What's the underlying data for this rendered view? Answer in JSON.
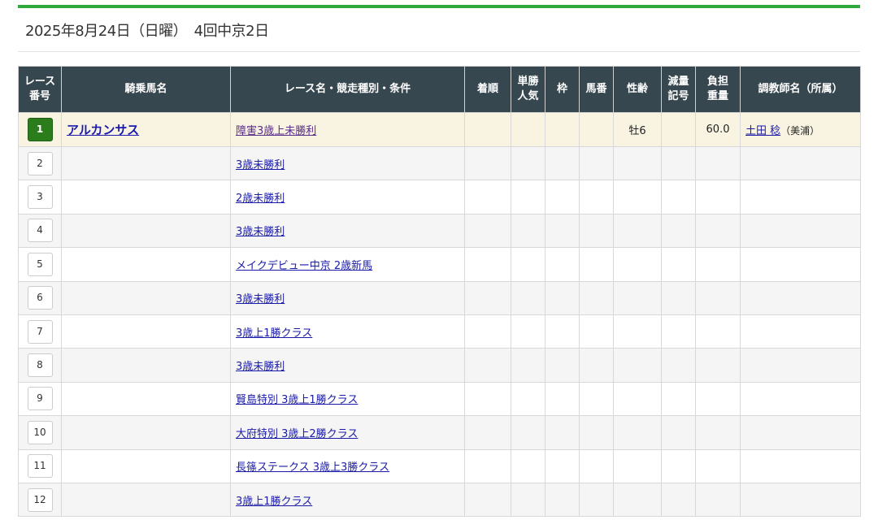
{
  "title": "2025年8月24日（日曜）　4回中京2日",
  "headers": [
    "レース\n番号",
    "騎乗馬名",
    "レース名・競走種別・条件",
    "着順",
    "単勝\n人気",
    "枠",
    "馬番",
    "性齢",
    "減量\n記号",
    "負担\n重量",
    "調教師名（所属）"
  ],
  "rows": [
    {
      "no": "1",
      "horse": "アルカンサス",
      "race": "障害3歳上未勝利",
      "sexage": "牡6",
      "weight": "60.0",
      "trainer": "土田 稔",
      "affil": "（美浦）"
    },
    {
      "no": "2",
      "race": "3歳未勝利"
    },
    {
      "no": "3",
      "race": "2歳未勝利"
    },
    {
      "no": "4",
      "race": "3歳未勝利"
    },
    {
      "no": "5",
      "race": "メイクデビュー中京 2歳新馬"
    },
    {
      "no": "6",
      "race": "3歳未勝利"
    },
    {
      "no": "7",
      "race": "3歳上1勝クラス"
    },
    {
      "no": "8",
      "race": "3歳未勝利"
    },
    {
      "no": "9",
      "race": "賢島特別 3歳上1勝クラス"
    },
    {
      "no": "10",
      "race": "大府特別 3歳上2勝クラス"
    },
    {
      "no": "11",
      "race": "長篠ステークス 3歳上3勝クラス"
    },
    {
      "no": "12",
      "race": "3歳上1勝クラス"
    }
  ],
  "colors": {
    "accent": "#2eaa3c",
    "header_bg": "#37474f",
    "active_race": "#2a7d1a",
    "highlight_row": "#f8f4e1"
  }
}
